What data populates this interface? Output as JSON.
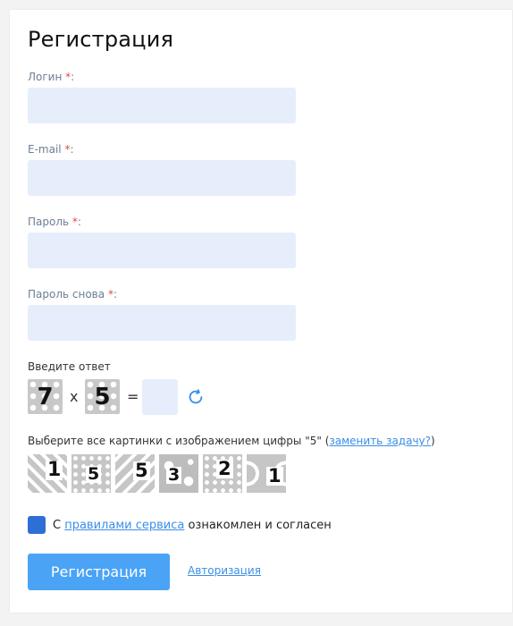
{
  "form": {
    "title": "Регистрация",
    "required_mark": "*",
    "colon": ":",
    "fields": [
      {
        "label": "Логин",
        "value": "",
        "placeholder": ""
      },
      {
        "label": "E-mail",
        "value": "",
        "placeholder": ""
      },
      {
        "label": "Пароль",
        "value": "",
        "placeholder": ""
      },
      {
        "label": "Пароль снова",
        "value": "",
        "placeholder": ""
      }
    ]
  },
  "captcha": {
    "label": "Введите ответ",
    "operand_a": "7",
    "operator": "x",
    "operand_b": "5",
    "equals": "=",
    "answer": "",
    "refresh_icon": "refresh-icon"
  },
  "image_captcha": {
    "prompt_before": "Выберите все картинки с изображением цифры \"5\" (",
    "change_link": "заменить задачу?",
    "prompt_after": ")",
    "tiles": [
      {
        "digit": "1",
        "pattern": "chevron"
      },
      {
        "digit": "5",
        "pattern": "dots"
      },
      {
        "digit": "5",
        "pattern": "stripes"
      },
      {
        "digit": "3",
        "pattern": "stars"
      },
      {
        "digit": "2",
        "pattern": "dots"
      },
      {
        "digit": "1",
        "pattern": "arcs"
      }
    ]
  },
  "agreement": {
    "checked": true,
    "prefix": "С ",
    "link": "правилами сервиса",
    "suffix": " ознакомлен и согласен"
  },
  "actions": {
    "submit_label": "Регистрация",
    "auth_link": "Авторизация"
  },
  "colors": {
    "accent": "#4aa3f5",
    "checkbox": "#2e6fd6",
    "input_bg": "#e6eefb",
    "required": "#e0494b",
    "link": "#3a8ee6"
  }
}
